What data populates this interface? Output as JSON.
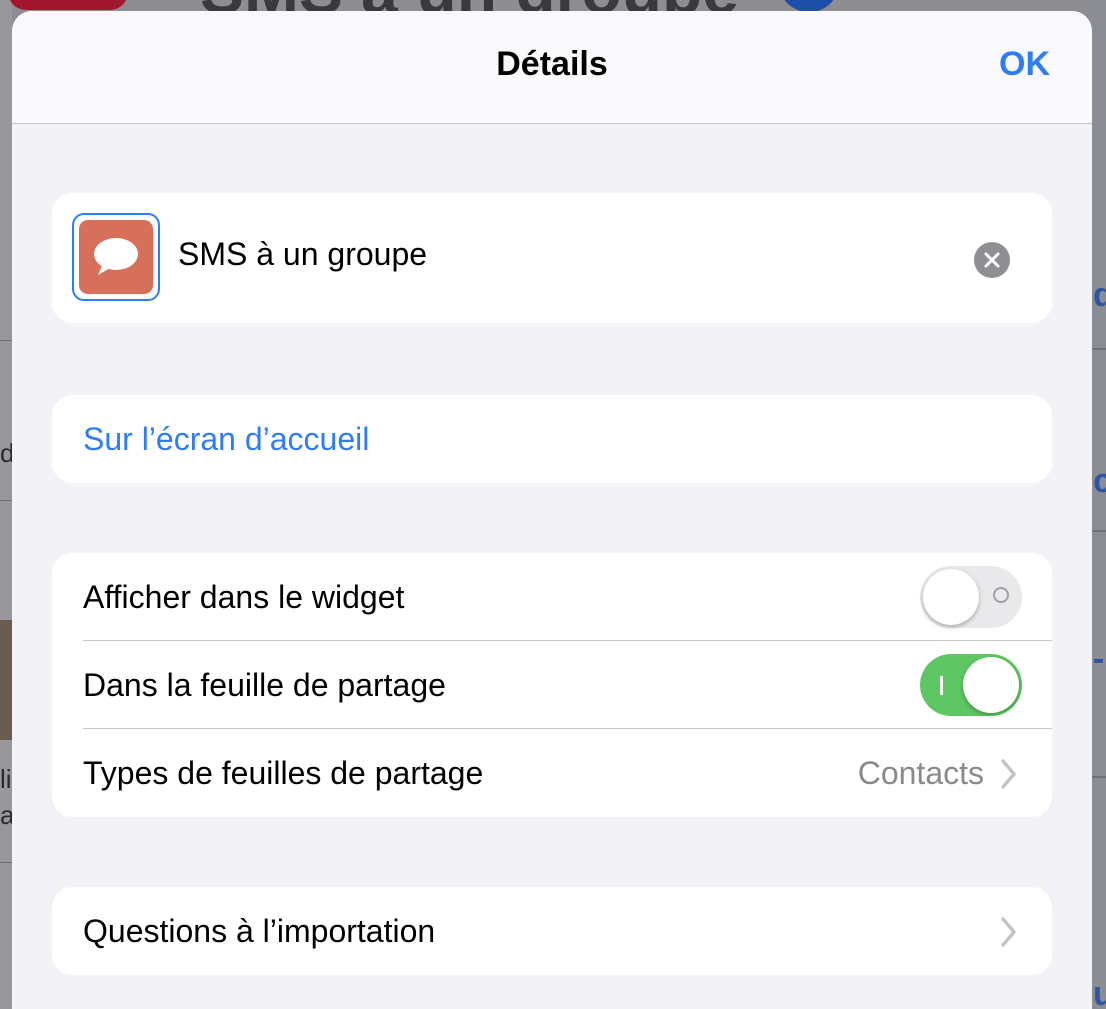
{
  "background": {
    "title_fragment": "SMS à un groupe",
    "right_fragments": [
      "d",
      "c",
      "-",
      "u"
    ],
    "left_fragments": [
      "d",
      "li",
      "ar"
    ]
  },
  "nav": {
    "title": "Détails",
    "ok_label": "OK"
  },
  "shortcut": {
    "icon": "speech-bubble-icon",
    "icon_color": "#d7705a",
    "name": "SMS à un groupe",
    "clear_icon": "clear-circle-icon"
  },
  "home_screen": {
    "label": "Sur l’écran d’accueil"
  },
  "settings": {
    "widget": {
      "label": "Afficher dans le widget",
      "enabled": false
    },
    "share_sheet": {
      "label": "Dans la feuille de partage",
      "enabled": true
    },
    "share_types": {
      "label": "Types de feuilles de partage",
      "value": "Contacts"
    }
  },
  "import": {
    "label": "Questions à l’importation"
  },
  "colors": {
    "accent": "#2f7cf6",
    "toggle_on": "#5ec763",
    "toggle_off": "#e9e9eb",
    "grouped_background": "#f2f2f7"
  }
}
